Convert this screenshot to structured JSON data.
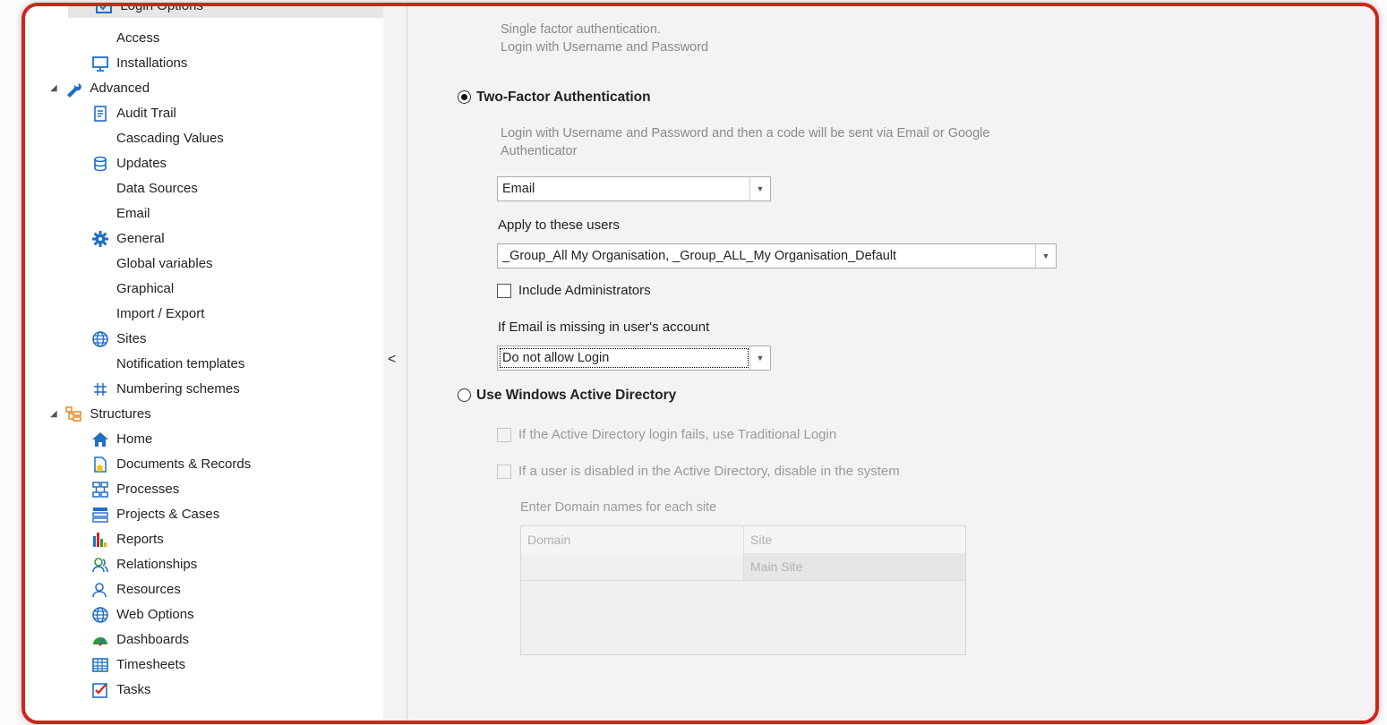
{
  "sidebar": {
    "items": [
      {
        "label": "Login Options",
        "icon": "login-options-icon"
      },
      {
        "label": "Access"
      },
      {
        "label": "Installations",
        "icon": "monitor-icon"
      },
      {
        "label": "Advanced",
        "icon": "wrench-icon"
      },
      {
        "label": "Audit Trail",
        "icon": "audit-trail-icon"
      },
      {
        "label": "Cascading Values"
      },
      {
        "label": "Updates",
        "icon": "updates-icon"
      },
      {
        "label": "Data Sources"
      },
      {
        "label": "Email"
      },
      {
        "label": "General",
        "icon": "gear-icon"
      },
      {
        "label": "Global variables"
      },
      {
        "label": "Graphical"
      },
      {
        "label": "Import / Export"
      },
      {
        "label": "Sites",
        "icon": "globe-icon"
      },
      {
        "label": "Notification templates"
      },
      {
        "label": "Numbering schemes",
        "icon": "hash-icon"
      },
      {
        "label": "Structures",
        "icon": "structures-icon"
      },
      {
        "label": "Home",
        "icon": "home-icon"
      },
      {
        "label": "Documents & Records",
        "icon": "documents-icon"
      },
      {
        "label": "Processes",
        "icon": "processes-icon"
      },
      {
        "label": "Projects & Cases",
        "icon": "projects-icon"
      },
      {
        "label": "Reports",
        "icon": "reports-icon"
      },
      {
        "label": "Relationships",
        "icon": "relationships-icon"
      },
      {
        "label": "Resources",
        "icon": "resources-icon"
      },
      {
        "label": "Web Options",
        "icon": "globe-icon"
      },
      {
        "label": "Dashboards",
        "icon": "dashboard-icon"
      },
      {
        "label": "Timesheets",
        "icon": "timesheet-icon"
      },
      {
        "label": "Tasks",
        "icon": "tasks-icon"
      }
    ]
  },
  "splitter": {
    "collapse_glyph": "<"
  },
  "main": {
    "single_factor_line1": "Single factor authentication.",
    "single_factor_line2": "Login with Username and Password",
    "two_factor": {
      "label": "Two-Factor Authentication",
      "selected": true,
      "description_line1": "Login with Username and Password and then a code will be sent via Email or Google",
      "description_line2": "Authenticator",
      "method_value": "Email",
      "apply_label": "Apply to these users",
      "users_value": "_Group_All My Organisation, _Group_ALL_My Organisation_Default",
      "include_admins_label": "Include Administrators",
      "include_admins_checked": false,
      "missing_email_label": "If Email is missing in user's account",
      "missing_email_value": "Do not allow Login"
    },
    "active_directory": {
      "label": "Use Windows Active Directory",
      "selected": false,
      "fallback_label": "If the Active Directory login fails, use Traditional Login",
      "disable_label": "If a user is disabled in the Active Directory, disable in the system",
      "domain_names_label": "Enter Domain names for each site",
      "grid": {
        "columns": [
          "Domain",
          "Site"
        ],
        "rows": [
          [
            "",
            "Main Site"
          ]
        ]
      }
    }
  },
  "colors": {
    "frame_border": "#d2231c",
    "accent_blue": "#1f6fc5"
  }
}
